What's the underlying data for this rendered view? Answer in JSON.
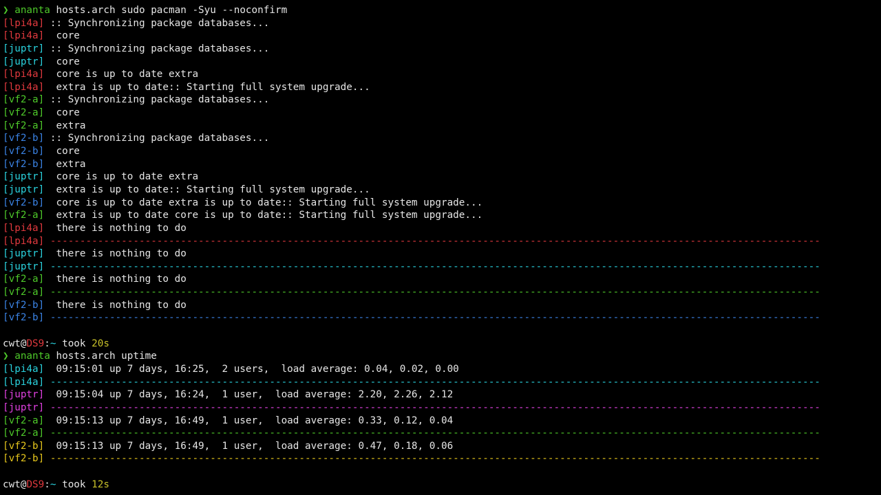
{
  "colors": {
    "text": "#e6e6e6",
    "lpi4a": "#e0393e",
    "juptr": "#2ad2de",
    "vf2a": "#4ec92a",
    "vf2b": "#3a82e3",
    "magenta": "#e040e0",
    "yellow": "#e5c51c",
    "prompt_green": "#4ec92a",
    "host_red": "#e0393e",
    "path_cyan": "#2ad2de",
    "took_yellow": "#c9c22a"
  },
  "lines": [
    {
      "type": "prompt",
      "arrow": "❯",
      "dir": "ananta",
      "cmd": " hosts.arch sudo pacman -Syu --noconfirm"
    },
    {
      "type": "out",
      "tag": "[lpi4a]",
      "color": "lpi4a",
      "text": " :: Synchronizing package databases..."
    },
    {
      "type": "out",
      "tag": "[lpi4a]",
      "color": "lpi4a",
      "text": "  core"
    },
    {
      "type": "out",
      "tag": "[juptr]",
      "color": "juptr",
      "text": " :: Synchronizing package databases..."
    },
    {
      "type": "out",
      "tag": "[juptr]",
      "color": "juptr",
      "text": "  core"
    },
    {
      "type": "out",
      "tag": "[lpi4a]",
      "color": "lpi4a",
      "text": "  core is up to date extra"
    },
    {
      "type": "out",
      "tag": "[lpi4a]",
      "color": "lpi4a",
      "text": "  extra is up to date:: Starting full system upgrade..."
    },
    {
      "type": "out",
      "tag": "[vf2-a]",
      "color": "vf2a",
      "text": " :: Synchronizing package databases..."
    },
    {
      "type": "out",
      "tag": "[vf2-a]",
      "color": "vf2a",
      "text": "  core"
    },
    {
      "type": "out",
      "tag": "[vf2-a]",
      "color": "vf2a",
      "text": "  extra"
    },
    {
      "type": "out",
      "tag": "[vf2-b]",
      "color": "vf2b",
      "text": " :: Synchronizing package databases..."
    },
    {
      "type": "out",
      "tag": "[vf2-b]",
      "color": "vf2b",
      "text": "  core"
    },
    {
      "type": "out",
      "tag": "[vf2-b]",
      "color": "vf2b",
      "text": "  extra"
    },
    {
      "type": "out",
      "tag": "[juptr]",
      "color": "juptr",
      "text": "  core is up to date extra"
    },
    {
      "type": "out",
      "tag": "[juptr]",
      "color": "juptr",
      "text": "  extra is up to date:: Starting full system upgrade..."
    },
    {
      "type": "out",
      "tag": "[vf2-b]",
      "color": "vf2b",
      "text": "  core is up to date extra is up to date:: Starting full system upgrade..."
    },
    {
      "type": "out",
      "tag": "[vf2-a]",
      "color": "vf2a",
      "text": "  extra is up to date core is up to date:: Starting full system upgrade..."
    },
    {
      "type": "out",
      "tag": "[lpi4a]",
      "color": "lpi4a",
      "text": "  there is nothing to do"
    },
    {
      "type": "sep",
      "tag": "[lpi4a]",
      "color": "lpi4a",
      "text": " ----------------------------------------------------------------------------------------------------------------------------------"
    },
    {
      "type": "out",
      "tag": "[juptr]",
      "color": "juptr",
      "text": "  there is nothing to do"
    },
    {
      "type": "sep",
      "tag": "[juptr]",
      "color": "juptr",
      "text": " ----------------------------------------------------------------------------------------------------------------------------------"
    },
    {
      "type": "out",
      "tag": "[vf2-a]",
      "color": "vf2a",
      "text": "  there is nothing to do"
    },
    {
      "type": "sep",
      "tag": "[vf2-a]",
      "color": "vf2a",
      "text": " ----------------------------------------------------------------------------------------------------------------------------------"
    },
    {
      "type": "out",
      "tag": "[vf2-b]",
      "color": "vf2b",
      "text": "  there is nothing to do"
    },
    {
      "type": "sep",
      "tag": "[vf2-b]",
      "color": "vf2b",
      "text": " ----------------------------------------------------------------------------------------------------------------------------------"
    },
    {
      "type": "blank"
    },
    {
      "type": "status",
      "user": "cwt",
      "at": "@",
      "host": "DS9",
      "colon": ":",
      "path": "~",
      "took_label": " took ",
      "took": "20s"
    },
    {
      "type": "prompt",
      "arrow": "❯",
      "dir": "ananta",
      "cmd": " hosts.arch uptime"
    },
    {
      "type": "out",
      "tag": "[lpi4a]",
      "color": "juptr",
      "text": "  09:15:01 up 7 days, 16:25,  2 users,  load average: 0.04, 0.02, 0.00"
    },
    {
      "type": "sep",
      "tag": "[lpi4a]",
      "color": "juptr",
      "text": " ----------------------------------------------------------------------------------------------------------------------------------"
    },
    {
      "type": "out",
      "tag": "[juptr]",
      "color": "magenta",
      "text": "  09:15:04 up 7 days, 16:24,  1 user,  load average: 2.20, 2.26, 2.12"
    },
    {
      "type": "sep",
      "tag": "[juptr]",
      "color": "magenta",
      "text": " ----------------------------------------------------------------------------------------------------------------------------------"
    },
    {
      "type": "out",
      "tag": "[vf2-a]",
      "color": "vf2a",
      "text": "  09:15:13 up 7 days, 16:49,  1 user,  load average: 0.33, 0.12, 0.04"
    },
    {
      "type": "sep",
      "tag": "[vf2-a]",
      "color": "vf2a",
      "text": " ----------------------------------------------------------------------------------------------------------------------------------"
    },
    {
      "type": "out",
      "tag": "[vf2-b]",
      "color": "yellow",
      "text": "  09:15:13 up 7 days, 16:49,  1 user,  load average: 0.47, 0.18, 0.06"
    },
    {
      "type": "sep",
      "tag": "[vf2-b]",
      "color": "yellow",
      "text": " ----------------------------------------------------------------------------------------------------------------------------------"
    },
    {
      "type": "blank"
    },
    {
      "type": "status",
      "user": "cwt",
      "at": "@",
      "host": "DS9",
      "colon": ":",
      "path": "~",
      "took_label": " took ",
      "took": "12s"
    }
  ]
}
